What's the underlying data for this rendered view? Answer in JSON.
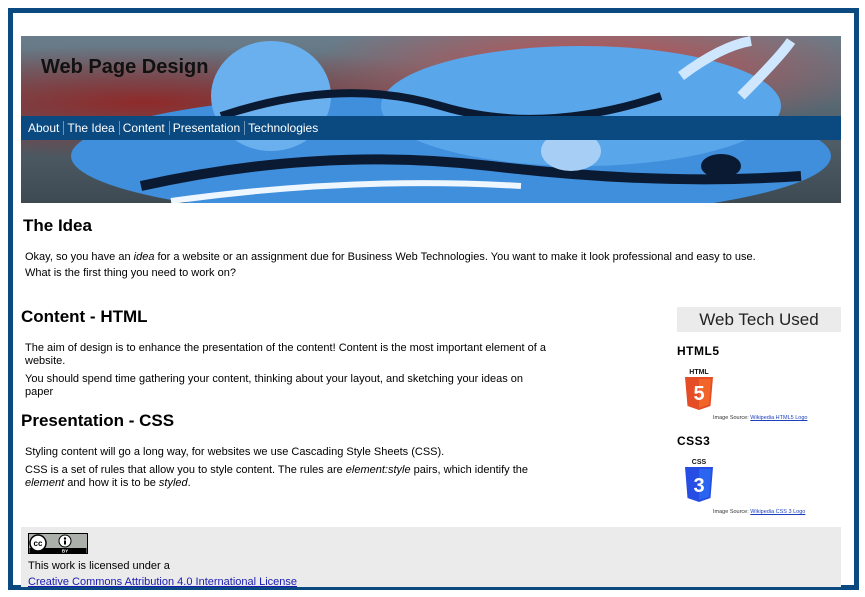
{
  "header": {
    "title": "Web Page Design"
  },
  "nav": [
    "About",
    "The Idea",
    "Content",
    "Presentation",
    "Technologies"
  ],
  "idea": {
    "heading": "The Idea",
    "p1_before": "Okay, so you have an ",
    "p1_em": "idea",
    "p1_after": " for a website or an assignment due for Business Web Technologies. You want to make it look professional and easy to use.",
    "p2": "What is the first thing you need to work on?"
  },
  "content": {
    "heading": "Content - HTML",
    "p1": "The aim of design is to enhance the presentation of the content! Content is the most important element of a website.",
    "p2": "You should spend time gathering your content, thinking about your layout, and sketching your ideas on paper"
  },
  "presentation": {
    "heading": "Presentation - CSS",
    "p1": "Styling content will go a long way, for websites we use Cascading Style Sheets (CSS).",
    "p2_a": "CSS is a set of rules that allow you to style content. The rules are ",
    "p2_em1": "element:style",
    "p2_b": " pairs, which identify the ",
    "p2_em2": "element",
    "p2_c": " and how it is to be ",
    "p2_em3": "styled",
    "p2_d": "."
  },
  "aside": {
    "heading": "Web Tech Used",
    "html5": {
      "name": "HTML5",
      "logo_text": "HTML",
      "logo_num": "5",
      "credit_prefix": "Image Source: ",
      "credit_link": "Wikipedia HTML5 Logo"
    },
    "css3": {
      "name": "CSS3",
      "logo_text": "CSS",
      "logo_num": "3",
      "credit_prefix": "Image Source: ",
      "credit_link": "Wikipedia CSS 3 Logo"
    }
  },
  "footer": {
    "badge_cc": "cc",
    "badge_by": "BY",
    "license_text": "This work is licensed under a",
    "license_link": "Creative Commons Attribution 4.0 International License"
  },
  "colors": {
    "frame": "#0b4a80",
    "nav": "#0b4a80",
    "html5_orange": "#e44d26",
    "css3_blue": "#264de4"
  }
}
